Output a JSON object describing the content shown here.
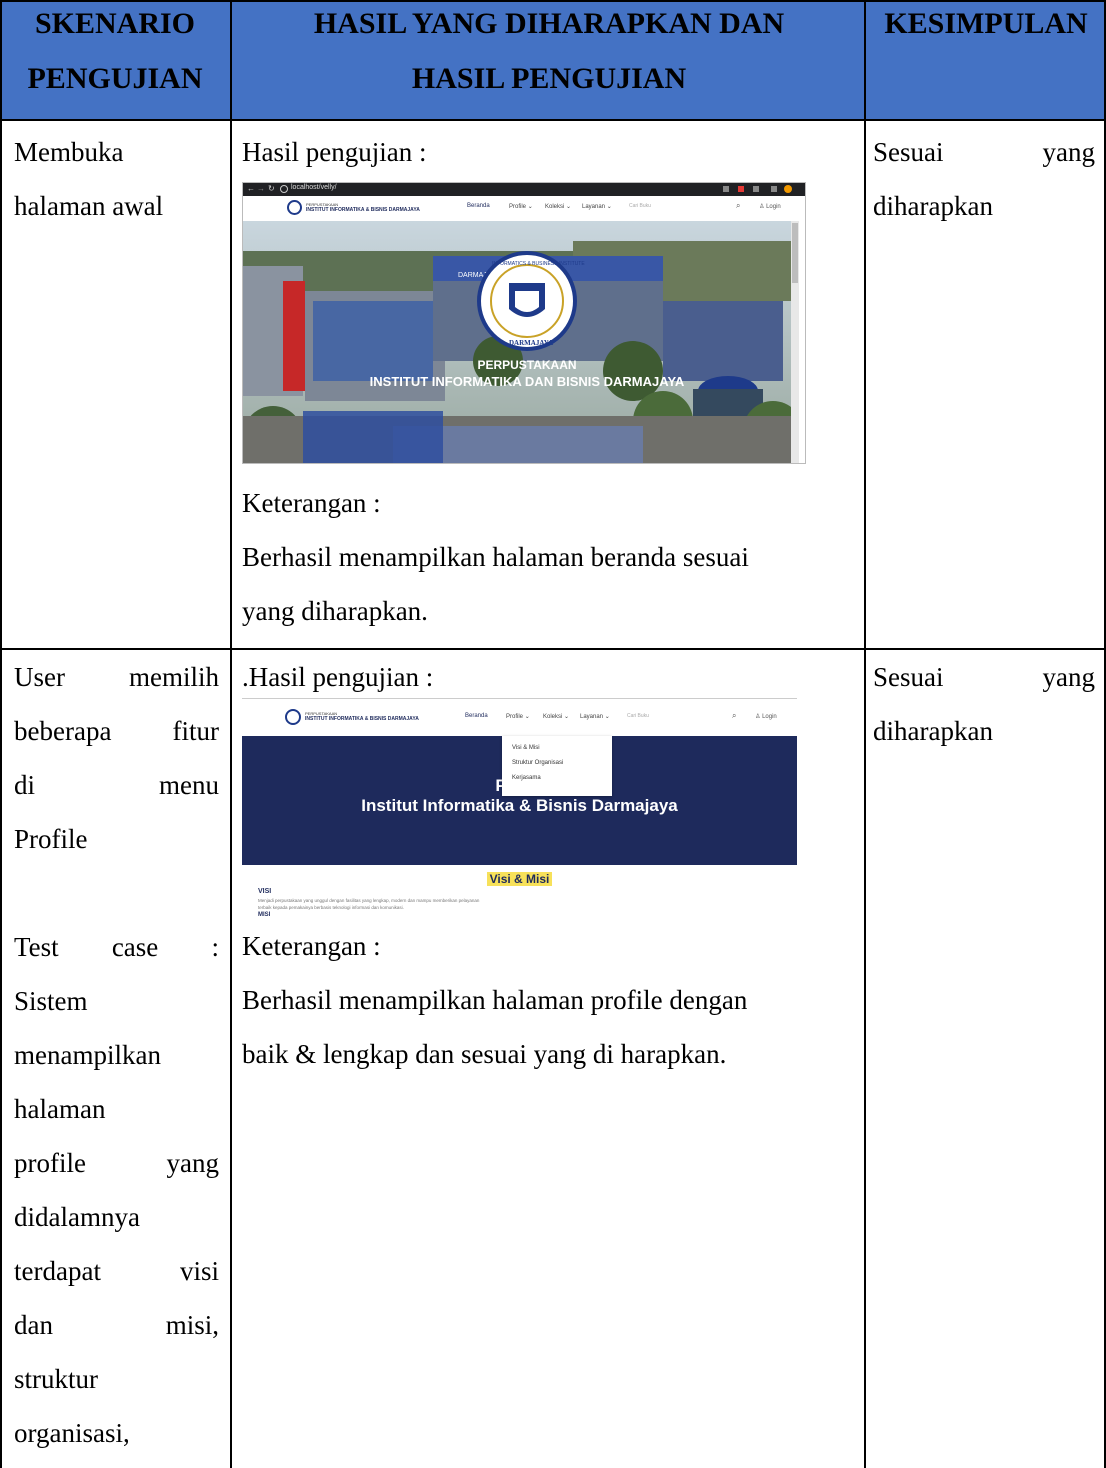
{
  "table": {
    "headers": {
      "col1": [
        "SKENARIO",
        "PENGUJIAN"
      ],
      "col2": [
        "HASIL YANG DIHARAPKAN DAN",
        "HASIL PENGUJIAN"
      ],
      "col3": "KESIMPULAN"
    },
    "rows": [
      {
        "scenario": [
          "Membuka",
          "halaman awal"
        ],
        "result_label": "Hasil pengujian :",
        "note_label": "Keterangan :",
        "note_lines": [
          "Berhasil menampilkan halaman beranda sesuai",
          "yang diharapkan."
        ],
        "conclusion": [
          "Sesuai",
          "yang",
          "diharapkan"
        ]
      },
      {
        "scenario": [
          "User memilih",
          "beberapa fitur",
          "di menu",
          "Profile",
          "",
          "Test case :",
          "Sistem",
          "menampilkan",
          "halaman",
          "profile yang",
          "didalamnya",
          "terdapat visi",
          "dan misi,",
          "struktur",
          "organisasi,"
        ],
        "result_label": ".Hasil pengujian :",
        "note_label": "Keterangan :",
        "note_lines": [
          "Berhasil menampilkan halaman profile dengan",
          "baik & lengkap dan sesuai yang di harapkan."
        ],
        "conclusion": [
          "Sesuai",
          "yang",
          "diharapkan"
        ]
      }
    ]
  },
  "screenshot1": {
    "url": "localhost/velly/",
    "logo_small": "PERPUSTAKAAN",
    "logo_big": "INSTITUT INFORMATIKA & BISNIS DARMAJAYA",
    "nav": [
      "Beranda",
      "Profile",
      "Koleksi",
      "Layanan"
    ],
    "search_placeholder": "Cari Buku",
    "login": "Login",
    "building_sign": "DARMAJAYA",
    "seal_text": "INFORMATICS & BUSINESS INSTITUTE",
    "seal_bottom": "DARMAJAYA",
    "hero_line1": "PERPUSTAKAAN",
    "hero_line2": "INSTITUT INFORMATIKA DAN BISNIS DARMAJAYA"
  },
  "screenshot2": {
    "logo_small": "PERPUSTAKAAN",
    "logo_big": "INSTITUT INFORMATIKA & BISNIS DARMAJAYA",
    "nav": [
      "Beranda",
      "Profile",
      "Koleksi",
      "Layanan"
    ],
    "search_placeholder": "Cari Buku",
    "login": "Login",
    "dropdown": [
      "Visi & Misi",
      "Struktur Organisasi",
      "Kerjasama"
    ],
    "banner_line1": "Perpu",
    "banner_line2": "Institut Informatika & Bisnis Darmajaya",
    "section_title": "Visi & Misi",
    "visi_heading": "VISI",
    "visi_text_1": "Menjadi perpustakaan yang unggul dengan fasilitas yang lengkap, modern dan mampu memberikan pelayanan",
    "visi_text_2": "terbaik kepada pemakainya berbasis teknologi informasi dan komunikasi.",
    "misi_heading": "MISI"
  },
  "colors": {
    "header_bg": "#4472c4",
    "banner_bg": "#1e2a5c",
    "highlight": "#f7e15a"
  }
}
